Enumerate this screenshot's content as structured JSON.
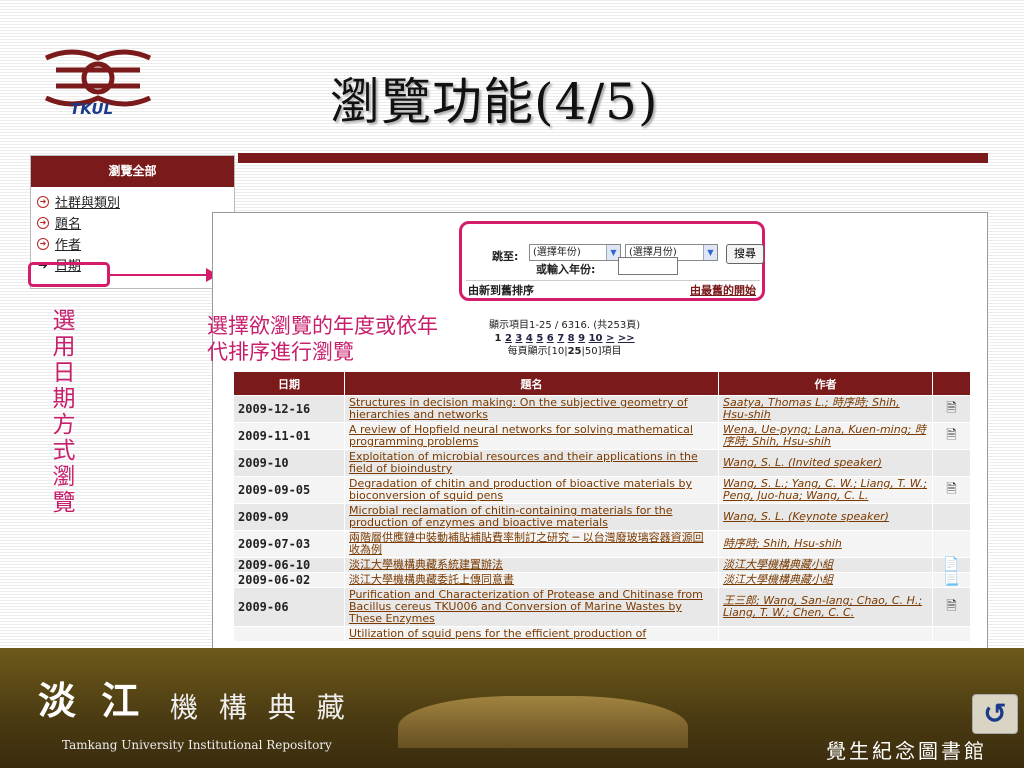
{
  "slide": {
    "title": "瀏覽功能(4/5)"
  },
  "logo": {
    "text": "TKUL"
  },
  "sidebar": {
    "header": "瀏覽全部",
    "items": [
      {
        "label": "社群與類別"
      },
      {
        "label": "題名"
      },
      {
        "label": "作者"
      },
      {
        "label": "日期"
      }
    ]
  },
  "jump": {
    "label": "跳至:",
    "year_select": "(選擇年份)",
    "month_select": "(選擇月份)",
    "search_button": "搜尋",
    "input_label": "或輸入年份:",
    "sort_new": "由新到舊排序",
    "sort_old": "由最舊的開始"
  },
  "pager": {
    "summary": "顯示項目1-25 / 6316. (共253頁)",
    "current_page": "1",
    "pages": [
      "2",
      "3",
      "4",
      "5",
      "6",
      "7",
      "8",
      "9",
      "10",
      ">",
      ">>"
    ],
    "per_page_prefix": "每頁顯示[",
    "per_page_10": "10",
    "per_page_25": "25",
    "per_page_50": "50",
    "per_page_suffix": "]項目"
  },
  "annotation": {
    "line1": "選擇欲瀏覽的年度或依年",
    "line2": "代排序進行瀏覽",
    "vertical": "選用日期方式瀏覽"
  },
  "table": {
    "headers": {
      "date": "日期",
      "title": "題名",
      "author": "作者"
    },
    "rows": [
      {
        "date": "2009-12-16",
        "title": "Structures in decision making: On the subjective geometry of hierarchies and networks",
        "author": "Saatya, Thomas L.; 時序時; Shih, Hsu-shih",
        "icon": "doc-icon"
      },
      {
        "date": "2009-11-01",
        "title": "A review of Hopfield neural networks for solving mathematical programming problems",
        "author": "Wena, Ue-pyng; Lana, Kuen-ming; 時序時; Shih, Hsu-shih",
        "icon": "doc-icon"
      },
      {
        "date": "2009-10",
        "title": "Exploitation of microbial resources and their applications in the field of bioindustry",
        "author": "Wang, S. L. (Invited speaker)",
        "icon": ""
      },
      {
        "date": "2009-09-05",
        "title": "Degradation of chitin and production of bioactive materials by bioconversion of squid pens",
        "author": "Wang, S. L.; Yang, C. W.; Liang, T. W.; Peng, Juo-hua; Wang, C. L.",
        "icon": "doc-icon"
      },
      {
        "date": "2009-09",
        "title": "Microbial reclamation of chitin-containing materials for the production of enzymes and bioactive materials",
        "author": "Wang, S. L. (Keynote speaker)",
        "icon": ""
      },
      {
        "date": "2009-07-03",
        "title": "兩階層供應鏈中裝動補貼補貼費率制訂之研究 ─ 以台灣廢玻璃容器資源回收為例",
        "author": "時序時; Shih, Hsu-shih",
        "icon": ""
      },
      {
        "date": "2009-06-10",
        "title": "淡江大學機構典藏系統建置辦法",
        "author": "淡江大學機構典藏小組",
        "icon": "pdf-icon"
      },
      {
        "date": "2009-06-02",
        "title": "淡江大學機構典藏委託上傳同意書",
        "author": "淡江大學機構典藏小組",
        "icon": "word-icon"
      },
      {
        "date": "2009-06",
        "title": "Purification and Characterization of Protease and Chitinase from Bacillus cereus TKU006 and Conversion of Marine Wastes by These Enzymes",
        "author": "王三郎; Wang, San-lang; Chao, C. H.; Liang, T. W.; Chen, C. C.",
        "icon": "doc-icon"
      },
      {
        "date": "",
        "title": "Utilization of squid pens for the efficient production of",
        "author": "",
        "icon": ""
      }
    ]
  },
  "footer": {
    "title": "淡 江",
    "subtitle": "機 構 典 藏",
    "english": "Tamkang University Institutional Repository",
    "library": "覺生紀念圖書館"
  },
  "colors": {
    "brand": "#7a1a1a",
    "accent": "#d41c6a",
    "annotation": "#c71f6c"
  }
}
